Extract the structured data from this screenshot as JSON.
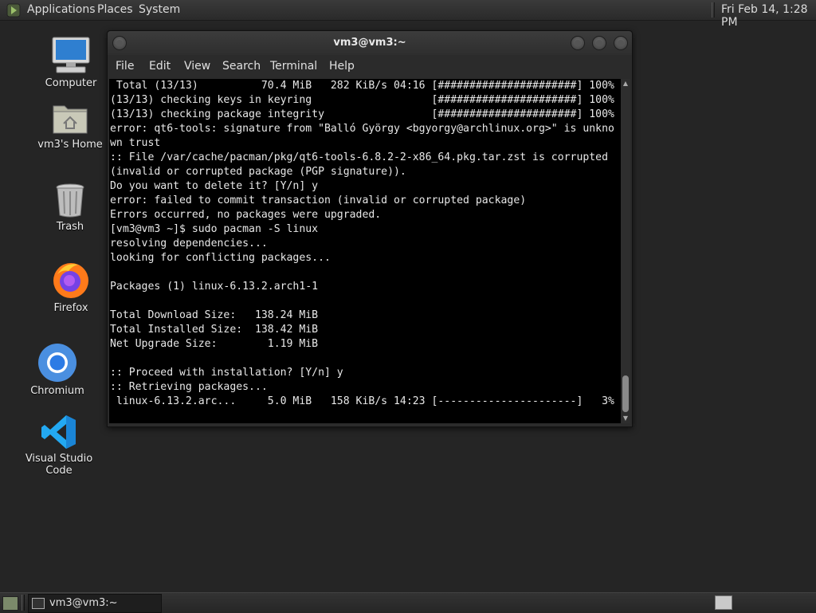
{
  "top_panel": {
    "menus": [
      "Applications",
      "Places",
      "System"
    ],
    "clock": "Fri Feb 14,  1:28 PM"
  },
  "desktop_icons": [
    {
      "label": "Computer",
      "icon": "computer-icon"
    },
    {
      "label": "vm3's Home",
      "icon": "home-folder-icon"
    },
    {
      "label": "Trash",
      "icon": "trash-icon"
    },
    {
      "label": "Firefox",
      "icon": "firefox-icon"
    },
    {
      "label": "Chromium",
      "icon": "chromium-icon"
    },
    {
      "label": "Visual Studio Code",
      "icon": "vscode-icon"
    }
  ],
  "terminal": {
    "title": "vm3@vm3:~",
    "menus": [
      "File",
      "Edit",
      "View",
      "Search",
      "Terminal",
      "Help"
    ],
    "lines": [
      " Total (13/13)          70.4 MiB   282 KiB/s 04:16 [######################] 100%",
      "(13/13) checking keys in keyring                   [######################] 100%",
      "(13/13) checking package integrity                 [######################] 100%",
      "error: qt6-tools: signature from \"Balló György <bgyorgy@archlinux.org>\" is unkno",
      "wn trust",
      ":: File /var/cache/pacman/pkg/qt6-tools-6.8.2-2-x86_64.pkg.tar.zst is corrupted",
      "(invalid or corrupted package (PGP signature)).",
      "Do you want to delete it? [Y/n] y",
      "error: failed to commit transaction (invalid or corrupted package)",
      "Errors occurred, no packages were upgraded.",
      "[vm3@vm3 ~]$ sudo pacman -S linux",
      "resolving dependencies...",
      "looking for conflicting packages...",
      "",
      "Packages (1) linux-6.13.2.arch1-1",
      "",
      "Total Download Size:   138.24 MiB",
      "Total Installed Size:  138.42 MiB",
      "Net Upgrade Size:        1.19 MiB",
      "",
      ":: Proceed with installation? [Y/n] y",
      ":: Retrieving packages...",
      " linux-6.13.2.arc...     5.0 MiB   158 KiB/s 14:23 [----------------------]   3%"
    ]
  },
  "bottom_panel": {
    "task_label": "vm3@vm3:~"
  },
  "colors": {
    "desktop_bg": "#252525",
    "terminal_bg": "#000000",
    "terminal_fg": "#e8e8e8"
  }
}
